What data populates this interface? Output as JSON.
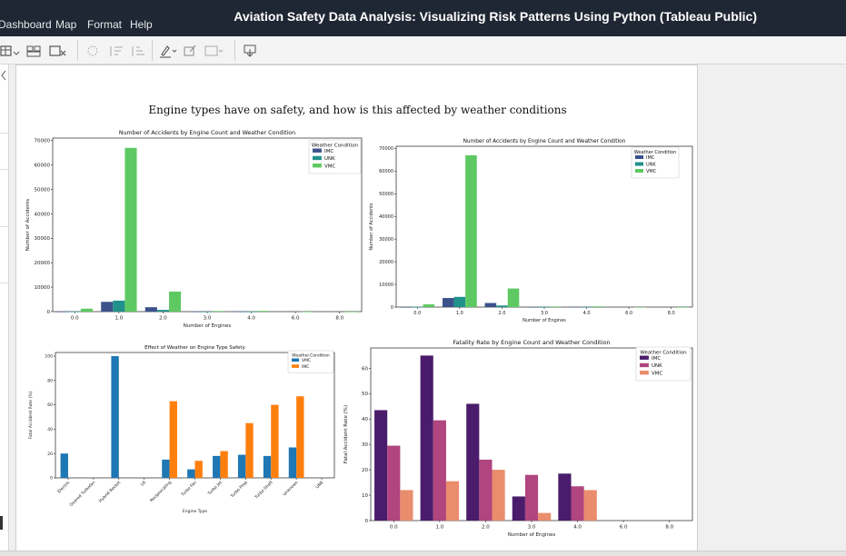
{
  "app": {
    "menus": [
      "Dashboard",
      "Map",
      "Format",
      "Help"
    ],
    "window_title": "Aviation Safety Data Analysis: Visualizing Risk Patterns Using Python (Tableau Public)"
  },
  "toolbar": {
    "icons": [
      "new-worksheet-icon",
      "new-dashboard-icon",
      "clear-sheet-icon",
      "group-icon",
      "sort-ascending-icon",
      "sort-descending-icon",
      "highlight-icon",
      "annotate-icon",
      "fit-icon",
      "download-icon"
    ]
  },
  "dashboard": {
    "title": "Engine types have on safety, and how is this affected by weather conditions"
  },
  "colors": {
    "imc_dark": "#3b528b",
    "unk_teal": "#21918c",
    "vmc_green": "#5ec962",
    "vmc_blue": "#1f77b4",
    "imc_orange": "#ff7f0e",
    "magma_imc": "#4a1c6b",
    "magma_unk": "#b0457f",
    "magma_vmc": "#ea8d6c"
  },
  "chart_data": [
    {
      "type": "bar",
      "title": "Number of Accidents by Engine Count and Weather Condition",
      "xlabel": "Number of Engines",
      "ylabel": "Number of Accidents",
      "x_ticks": [
        "0.0",
        "1.0",
        "2.0",
        "3.0",
        "4.0",
        "6.0",
        "8.0"
      ],
      "y_ticks": [
        "0",
        "10000",
        "20000",
        "30000",
        "40000",
        "50000",
        "60000",
        "70000"
      ],
      "ylim": [
        0,
        71000
      ],
      "legend_title": "Weather Condition",
      "legend_position": "top-right",
      "series": [
        {
          "name": "IMC",
          "color": "#3b528b",
          "values": [
            20,
            4000,
            1800,
            30,
            60,
            0,
            0
          ]
        },
        {
          "name": "UNK",
          "color": "#21918c",
          "values": [
            30,
            4500,
            700,
            10,
            20,
            0,
            0
          ]
        },
        {
          "name": "VMC",
          "color": "#5ec962",
          "values": [
            1200,
            67000,
            8200,
            250,
            300,
            10,
            5
          ]
        }
      ]
    },
    {
      "type": "bar",
      "title": "Number of Accidents by Engine Count and Weather Condition",
      "xlabel": "Number of Engines",
      "ylabel": "Number of Accidents",
      "x_ticks": [
        "0.0",
        "1.0",
        "2.0",
        "3.0",
        "4.0",
        "6.0",
        "8.0"
      ],
      "y_ticks": [
        "0",
        "10000",
        "20000",
        "30000",
        "40000",
        "50000",
        "60000",
        "70000"
      ],
      "ylim": [
        0,
        71000
      ],
      "legend_title": "Weather Condition",
      "legend_position": "top-right",
      "series": [
        {
          "name": "IMC",
          "color": "#3b528b",
          "values": [
            20,
            4000,
            1800,
            30,
            60,
            0,
            0
          ]
        },
        {
          "name": "UNK",
          "color": "#21918c",
          "values": [
            30,
            4500,
            700,
            10,
            20,
            0,
            0
          ]
        },
        {
          "name": "VMC",
          "color": "#5ec962",
          "values": [
            1200,
            67000,
            8200,
            250,
            300,
            10,
            5
          ]
        }
      ]
    },
    {
      "type": "bar",
      "title": "Effect of Weather on Engine Type Safety",
      "xlabel": "Engine Type",
      "ylabel": "Fatal Accident Rate (%)",
      "categories": [
        "Electric",
        "Geared Turbofan",
        "Hybrid Rocket",
        "LR",
        "Reciprocating",
        "Turbo Fan",
        "Turbo Jet",
        "Turbo Prop",
        "Turbo Shaft",
        "Unknown",
        "UNK"
      ],
      "y_ticks": [
        "0",
        "20",
        "40",
        "60",
        "80",
        "100"
      ],
      "ylim": [
        0,
        103
      ],
      "legend_title": "Weather.Condition",
      "legend_position": "top-right",
      "series": [
        {
          "name": "VMC",
          "color": "#1f77b4",
          "values": [
            20,
            0,
            100,
            0,
            15,
            7,
            18,
            19,
            18,
            25,
            0
          ]
        },
        {
          "name": "IMC",
          "color": "#ff7f0e",
          "values": [
            0,
            0,
            0,
            0,
            63,
            14,
            22,
            45,
            60,
            67,
            0
          ]
        }
      ]
    },
    {
      "type": "bar",
      "title": "Fatality Rate by Engine Count and Weather Condition",
      "xlabel": "Number of Engines",
      "ylabel": "Fatal Accident Rate (%)",
      "x_ticks": [
        "0.0",
        "1.0",
        "2.0",
        "3.0",
        "4.0",
        "6.0",
        "8.0"
      ],
      "y_ticks": [
        "0",
        "10",
        "20",
        "30",
        "40",
        "50",
        "60"
      ],
      "ylim": [
        0,
        68
      ],
      "legend_title": "Weather Condition",
      "legend_position": "top-right",
      "series": [
        {
          "name": "IMC",
          "color": "#4a1c6b",
          "values": [
            43.5,
            65,
            46,
            9.5,
            18.5,
            0,
            0
          ]
        },
        {
          "name": "UNK",
          "color": "#b0457f",
          "values": [
            29.5,
            39.5,
            24,
            18,
            13.5,
            0,
            0
          ]
        },
        {
          "name": "VMC",
          "color": "#ea8d6c",
          "values": [
            12,
            15.5,
            20,
            3,
            12,
            0,
            0
          ]
        }
      ]
    }
  ]
}
